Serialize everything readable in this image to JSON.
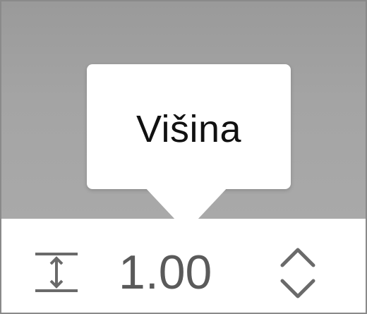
{
  "tooltip": {
    "label": "Višina"
  },
  "field": {
    "value": "1.00",
    "icon": "height-icon"
  },
  "stepper": {
    "up_icon": "chevron-up-icon",
    "down_icon": "chevron-down-icon"
  },
  "colors": {
    "backdrop": "#a4a4a4",
    "tooltip_bg": "#ffffff",
    "value_text": "#5a5a5a",
    "icon_stroke": "#6a6a6a"
  }
}
